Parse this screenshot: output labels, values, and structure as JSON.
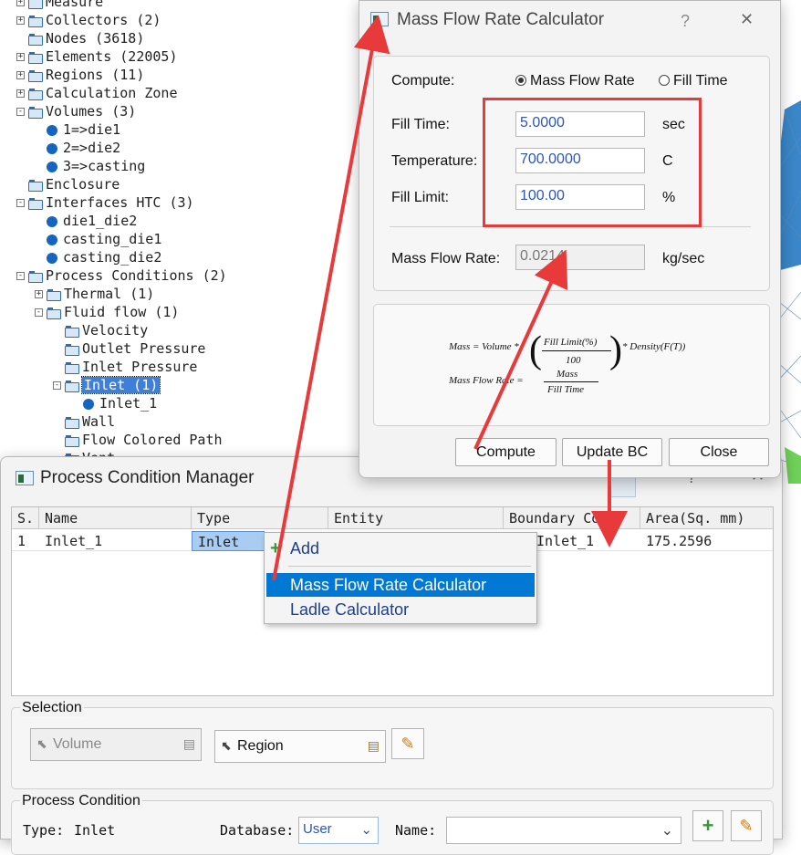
{
  "tree": {
    "items": [
      {
        "label": "Measure",
        "indent": 0,
        "icon": "folder",
        "pm": "+"
      },
      {
        "label": "Collectors (2)",
        "indent": 0,
        "icon": "folder",
        "pm": "+"
      },
      {
        "label": "Nodes (3618)",
        "indent": 0,
        "icon": "folder",
        "pm": ""
      },
      {
        "label": "Elements (22005)",
        "indent": 0,
        "icon": "folder",
        "pm": "+"
      },
      {
        "label": "Regions (11)",
        "indent": 0,
        "icon": "folder",
        "pm": "+"
      },
      {
        "label": "Calculation Zone",
        "indent": 0,
        "icon": "folder",
        "pm": "+"
      },
      {
        "label": "Volumes (3)",
        "indent": 0,
        "icon": "folder",
        "pm": "-"
      },
      {
        "label": "1=>die1",
        "indent": 1,
        "icon": "bullet",
        "pm": ""
      },
      {
        "label": "2=>die2",
        "indent": 1,
        "icon": "bullet",
        "pm": ""
      },
      {
        "label": "3=>casting",
        "indent": 1,
        "icon": "bullet",
        "pm": ""
      },
      {
        "label": "Enclosure",
        "indent": 0,
        "icon": "folder",
        "pm": ""
      },
      {
        "label": "Interfaces HTC (3)",
        "indent": 0,
        "icon": "folder",
        "pm": "-"
      },
      {
        "label": "die1_die2",
        "indent": 1,
        "icon": "bullet",
        "pm": ""
      },
      {
        "label": "casting_die1",
        "indent": 1,
        "icon": "bullet",
        "pm": ""
      },
      {
        "label": "casting_die2",
        "indent": 1,
        "icon": "bullet",
        "pm": ""
      },
      {
        "label": "Process Conditions (2)",
        "indent": 0,
        "icon": "folder",
        "pm": "-"
      },
      {
        "label": "Thermal (1)",
        "indent": 1,
        "icon": "folder",
        "pm": "+"
      },
      {
        "label": "Fluid  flow (1)",
        "indent": 1,
        "icon": "folder",
        "pm": "-"
      },
      {
        "label": "Velocity",
        "indent": 2,
        "icon": "folder",
        "pm": ""
      },
      {
        "label": "Outlet Pressure",
        "indent": 2,
        "icon": "folder",
        "pm": ""
      },
      {
        "label": "Inlet Pressure",
        "indent": 2,
        "icon": "folder",
        "pm": ""
      },
      {
        "label": "Inlet (1)",
        "indent": 2,
        "icon": "folder",
        "pm": "-",
        "selected": true
      },
      {
        "label": "Inlet_1",
        "indent": 3,
        "icon": "bullet",
        "pm": ""
      },
      {
        "label": "Wall",
        "indent": 2,
        "icon": "folder",
        "pm": ""
      },
      {
        "label": "Flow Colored Path",
        "indent": 2,
        "icon": "folder",
        "pm": ""
      },
      {
        "label": "Vent",
        "indent": 2,
        "icon": "folder",
        "pm": ""
      }
    ]
  },
  "mfr_dialog": {
    "title": "Mass Flow Rate Calculator",
    "help": "?",
    "close": "✕",
    "compute_label": "Compute:",
    "radio_mass": "Mass Flow Rate",
    "radio_fill": "Fill Time",
    "fill_time_label": "Fill Time:",
    "fill_time_value": "5.0000",
    "fill_time_unit": "sec",
    "temperature_label": "Temperature:",
    "temperature_value": "700.0000",
    "temperature_unit": "C",
    "fill_limit_label": "Fill Limit:",
    "fill_limit_value": "100.00",
    "fill_limit_unit": "%",
    "mfr_label": "Mass Flow Rate:",
    "mfr_value": "0.0214",
    "mfr_unit": "kg/sec",
    "formula": {
      "mass_lhs": "Mass = Volume *",
      "frac_num": "Fill Limit(%)",
      "frac_den": "100",
      "mass_rhs": "* Density(F(T))",
      "mfr_lhs": "Mass Flow Rate =",
      "mfr_num": "Mass",
      "mfr_den": "Fill Time"
    },
    "btn_compute": "Compute",
    "btn_update": "Update BC",
    "btn_close": "Close"
  },
  "pcm_dialog": {
    "title": "Process Condition Manager",
    "columns": [
      "S.",
      "Name",
      "Type",
      "Entity",
      "Boundary Cond.",
      "Area(Sq. mm)"
    ],
    "row": {
      "s": "1",
      "name": "Inlet_1",
      "type": "Inlet",
      "entity": "",
      "bc": "Inlet_1",
      "area": "175.2596"
    },
    "context_menu": {
      "add": "Add",
      "items": [
        "Mass Flow Rate Calculator",
        "Ladle Calculator"
      ]
    },
    "selection_label": "Selection",
    "volume_btn": "Volume",
    "region_btn": "Region",
    "process_condition_label": "Process Condition",
    "type_label": "Type:",
    "type_value": "Inlet",
    "database_label": "Database:",
    "database_value": "User",
    "name_label": "Name:"
  },
  "colors": {
    "accent_blue": "#0078d4",
    "annotation_red": "#e8393b",
    "mesh_blue": "#3a86c8"
  }
}
